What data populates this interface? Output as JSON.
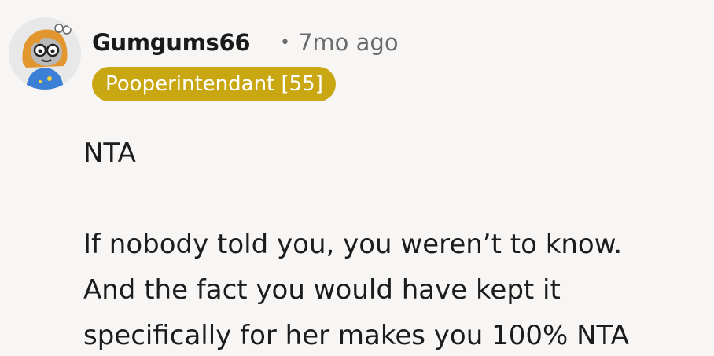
{
  "author": {
    "username": "Gumgums66",
    "avatar_icon": "cartoon-avatar-icon"
  },
  "meta": {
    "separator": "•",
    "timestamp": "7mo ago"
  },
  "flair": {
    "text": "Pooperintendant [55]",
    "color": "#c9a713"
  },
  "body": {
    "verdict": "NTA",
    "lines": [
      "If nobody told you, you weren’t to know.",
      "And the fact you would have kept it",
      "specifically for her makes you 100% NTA"
    ]
  }
}
